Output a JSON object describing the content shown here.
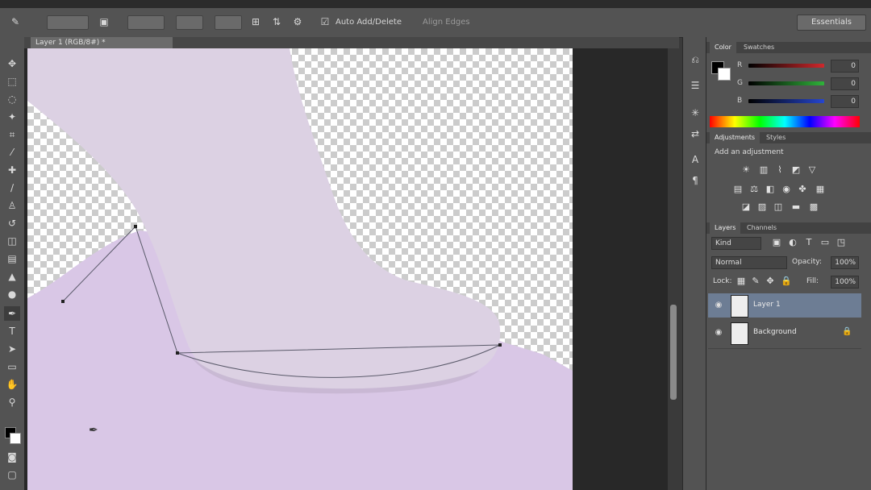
{
  "document": {
    "tab_title": "Layer 1 (RGB/8#) *"
  },
  "options_bar": {
    "antialias_label": "Auto Add/Delete",
    "align_edges_label": "Align Edges",
    "workspace": "Essentials"
  },
  "panels": {
    "color": {
      "tabs": [
        "Color",
        "Swatches"
      ],
      "labels": [
        "R",
        "G",
        "B"
      ],
      "values": [
        "0",
        "0",
        "0"
      ],
      "colors": {
        "r": "#d0282c",
        "g": "#2fb33a",
        "b": "#2646d0"
      }
    },
    "adjustments": {
      "tabs": [
        "Adjustments",
        "Styles"
      ],
      "header": "Add an adjustment"
    },
    "layers": {
      "tabs": [
        "Layers",
        "Channels"
      ],
      "filter": "Kind",
      "blend_mode": "Normal",
      "opacity_label": "Opacity:",
      "opacity_value": "100%",
      "lock_label": "Lock:",
      "fill_label": "Fill:",
      "fill_value": "100%",
      "items": [
        {
          "name": "Layer 1",
          "selected": true
        },
        {
          "name": "Background",
          "selected": false
        }
      ]
    }
  },
  "colors": {
    "selection": "#6d7d94",
    "backdrop": "#d9c7e6",
    "figure": "#dcd1e3"
  }
}
